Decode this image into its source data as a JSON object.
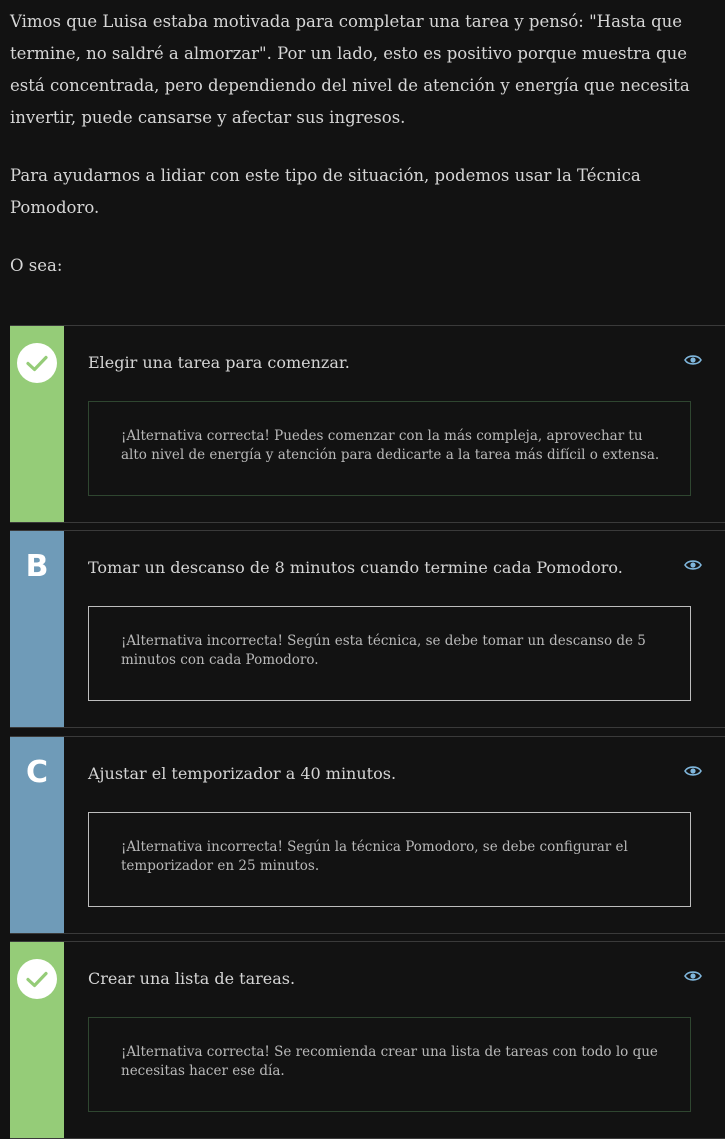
{
  "intro": {
    "paragraph1": "Vimos que Luisa estaba motivada para completar una tarea y pensó: \"Hasta que termine, no saldré a almorzar\". Por un lado, esto es positivo porque muestra que está concentrada, pero dependiendo del nivel de atención y energía que necesita invertir, puede cansarse y afectar sus ingresos.",
    "paragraph2": "Para ayudarnos a lidiar con este tipo de situación, podemos usar la Técnica Pomodoro.",
    "paragraph3": "O sea:"
  },
  "options": [
    {
      "status": "correct",
      "indicator": "check-icon",
      "text": "Elegir una tarea para comenzar.",
      "feedback": "¡Alternativa correcta! Puedes comenzar con la más compleja, aprovechar tu alto nivel de energía y atención para dedicarte a la tarea más difícil o extensa."
    },
    {
      "status": "incorrect",
      "letter": "B",
      "text": "Tomar un descanso de 8 minutos cuando termine cada Pomodoro.",
      "feedback": "¡Alternativa incorrecta! Según esta técnica, se debe tomar un descanso de 5 minutos con cada Pomodoro."
    },
    {
      "status": "incorrect",
      "letter": "C",
      "text": "Ajustar el temporizador a 40 minutos.",
      "feedback": "¡Alternativa incorrecta! Según la técnica Pomodoro, se debe configurar el temporizador en 25 minutos."
    },
    {
      "status": "correct",
      "indicator": "check-icon",
      "text": "Crear una lista de tareas.",
      "feedback": "¡Alternativa correcta! Se recomienda crear una lista de tareas con todo lo que necesitas hacer ese día."
    }
  ],
  "colors": {
    "background": "#121212",
    "correct_accent": "#95cc78",
    "incorrect_accent": "#6f9bb8",
    "eye_icon": "#7fb6dc"
  }
}
